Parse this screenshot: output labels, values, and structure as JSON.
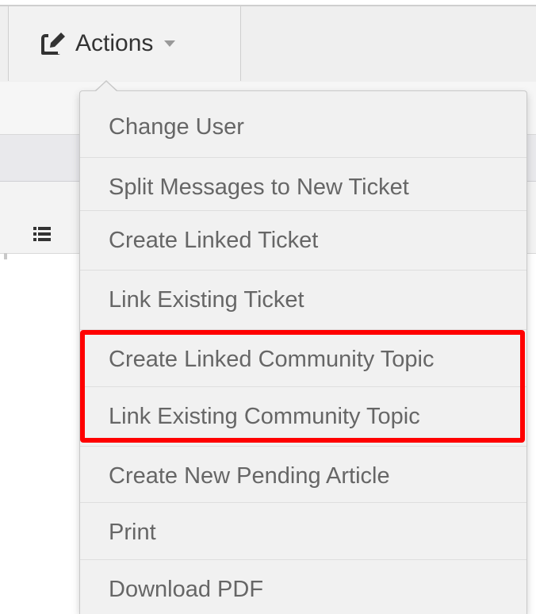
{
  "toolbar": {
    "actions_label": "Actions",
    "actions_icon": "edit-icon",
    "caret_icon": "caret-down-icon"
  },
  "background": {
    "list_icon": "list-icon"
  },
  "menu": {
    "items": [
      {
        "label": "Change User"
      },
      {
        "label": "Split Messages to New Ticket"
      },
      {
        "label": "Create Linked Ticket"
      },
      {
        "label": "Link Existing Ticket"
      },
      {
        "label": "Create Linked Community Topic"
      },
      {
        "label": "Link Existing Community Topic"
      },
      {
        "label": "Create New Pending Article"
      },
      {
        "label": "Print"
      },
      {
        "label": "Download PDF"
      }
    ]
  },
  "annotation": {
    "highlight_color": "#ff0000"
  }
}
